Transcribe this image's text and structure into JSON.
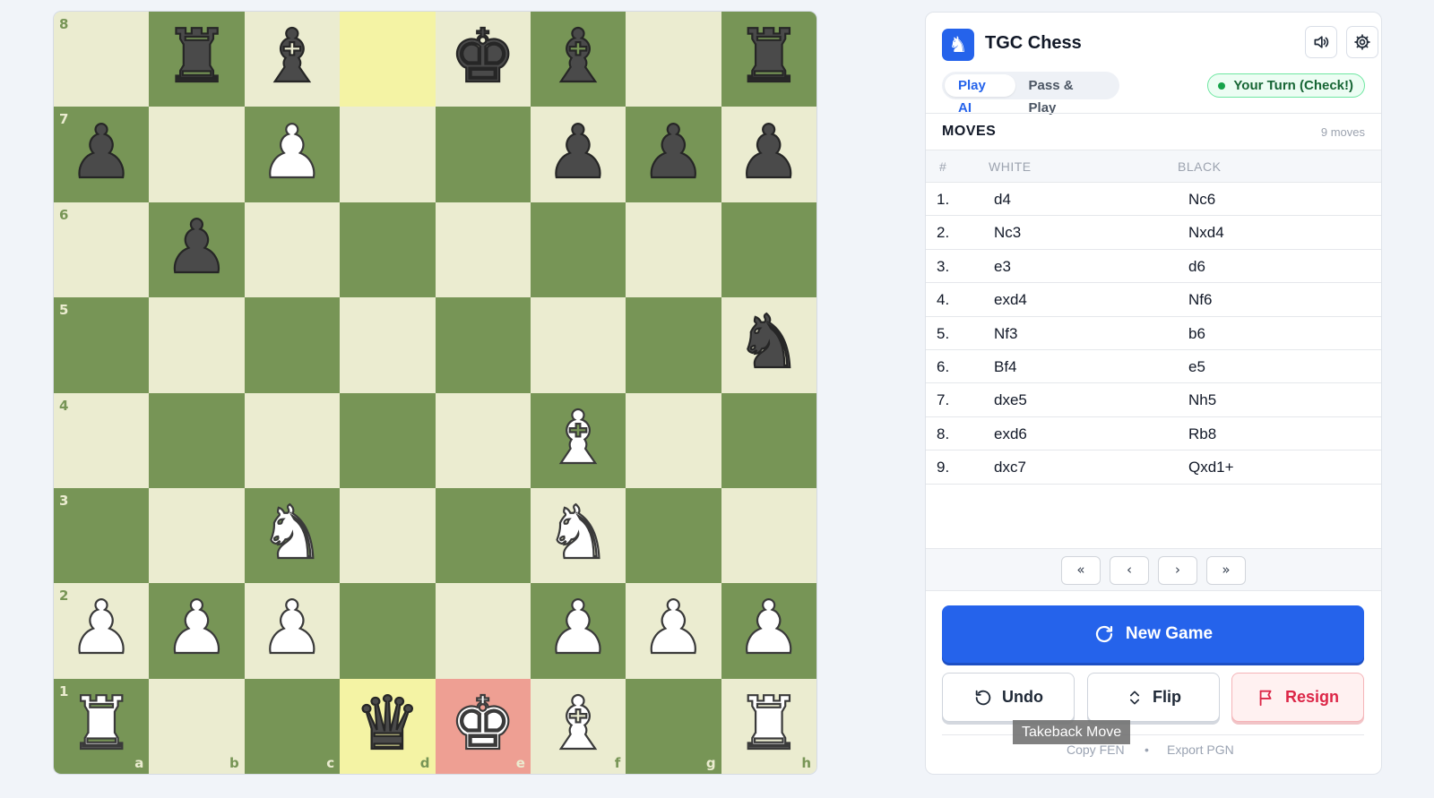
{
  "app": {
    "title": "TGC Chess",
    "logo_icon": "knight-icon",
    "sound_icon": "speaker-icon",
    "settings_icon": "gear-icon"
  },
  "modes": {
    "play_ai": "Play AI",
    "pass_play": "Pass & Play",
    "active": "play_ai"
  },
  "status": {
    "text": "Your Turn (Check!)",
    "color": "#16a34a"
  },
  "moves": {
    "title": "MOVES",
    "count": "9 moves",
    "columns": {
      "num": "#",
      "white": "WHITE",
      "black": "BLACK"
    },
    "rows": [
      {
        "num": "1.",
        "white": "d4",
        "black": "Nc6"
      },
      {
        "num": "2.",
        "white": "Nc3",
        "black": "Nxd4"
      },
      {
        "num": "3.",
        "white": "e3",
        "black": "d6"
      },
      {
        "num": "4.",
        "white": "exd4",
        "black": "Nf6"
      },
      {
        "num": "5.",
        "white": "Nf3",
        "black": "b6"
      },
      {
        "num": "6.",
        "white": "Bf4",
        "black": "e5"
      },
      {
        "num": "7.",
        "white": "dxe5",
        "black": "Nh5"
      },
      {
        "num": "8.",
        "white": "exd6",
        "black": "Rb8"
      },
      {
        "num": "9.",
        "white": "dxc7",
        "black": "Qxd1+"
      }
    ]
  },
  "nav": {
    "first": "«",
    "prev": "‹",
    "next": "›",
    "last": "»"
  },
  "buttons": {
    "new_game": "New Game",
    "undo": "Undo",
    "flip": "Flip",
    "resign": "Resign"
  },
  "footer": {
    "copy_fen": "Copy FEN",
    "separator": "•",
    "export_pgn": "Export PGN"
  },
  "tooltip": "Takeback Move",
  "board": {
    "ranks": [
      "8",
      "7",
      "6",
      "5",
      "4",
      "3",
      "2",
      "1"
    ],
    "files": [
      "a",
      "b",
      "c",
      "d",
      "e",
      "f",
      "g",
      "h"
    ],
    "position": [
      [
        "",
        "bR",
        "bB",
        "",
        "bK",
        "bB",
        "",
        "bR"
      ],
      [
        "bP",
        "",
        "wP",
        "",
        "",
        "bP",
        "bP",
        "bP"
      ],
      [
        "",
        "bP",
        "",
        "",
        "",
        "",
        "",
        ""
      ],
      [
        "",
        "",
        "",
        "",
        "",
        "",
        "",
        "bN"
      ],
      [
        "",
        "",
        "",
        "",
        "",
        "wB",
        "",
        ""
      ],
      [
        "",
        "",
        "wN",
        "",
        "",
        "wN",
        "",
        ""
      ],
      [
        "wP",
        "wP",
        "wP",
        "",
        "",
        "wP",
        "wP",
        "wP"
      ],
      [
        "wR",
        "",
        "",
        "bQ",
        "wK",
        "wB",
        "",
        "wR"
      ]
    ],
    "last_move_squares": [
      "d8",
      "d1"
    ],
    "check_square": "e1",
    "colors": {
      "light": "#ebecd0",
      "dark": "#779556",
      "highlight": "#f4f3a4",
      "check": "#ee9f93"
    }
  }
}
